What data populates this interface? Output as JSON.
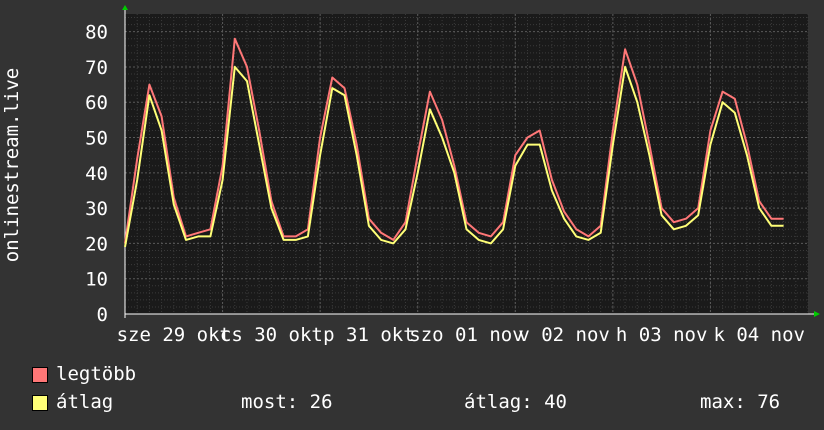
{
  "chart_data": {
    "type": "line",
    "ylabel": "onlinestream.live",
    "ylim": [
      0,
      85
    ],
    "y_ticks": [
      0,
      10,
      20,
      30,
      40,
      50,
      60,
      70,
      80
    ],
    "x_tick_labels": [
      "sze 29 okt",
      "cs 30 okt",
      "p 31 okt",
      "szo 01 nov",
      "v 02 nov",
      "h 03 nov",
      "k 04 nov"
    ],
    "x": [
      "sze 29 okt 00:00",
      "sze 29 okt 03:00",
      "sze 29 okt 06:00",
      "sze 29 okt 09:00",
      "sze 29 okt 12:00",
      "sze 29 okt 15:00",
      "sze 29 okt 18:00",
      "sze 29 okt 21:00",
      "cs 30 okt 00:00",
      "cs 30 okt 03:00",
      "cs 30 okt 06:00",
      "cs 30 okt 09:00",
      "cs 30 okt 12:00",
      "cs 30 okt 15:00",
      "cs 30 okt 18:00",
      "cs 30 okt 21:00",
      "p 31 okt 00:00",
      "p 31 okt 03:00",
      "p 31 okt 06:00",
      "p 31 okt 09:00",
      "p 31 okt 12:00",
      "p 31 okt 15:00",
      "p 31 okt 18:00",
      "p 31 okt 21:00",
      "szo 01 nov 00:00",
      "szo 01 nov 03:00",
      "szo 01 nov 06:00",
      "szo 01 nov 09:00",
      "szo 01 nov 12:00",
      "szo 01 nov 15:00",
      "szo 01 nov 18:00",
      "szo 01 nov 21:00",
      "v 02 nov 00:00",
      "v 02 nov 03:00",
      "v 02 nov 06:00",
      "v 02 nov 09:00",
      "v 02 nov 12:00",
      "v 02 nov 15:00",
      "v 02 nov 18:00",
      "v 02 nov 21:00",
      "h 03 nov 00:00",
      "h 03 nov 03:00",
      "h 03 nov 06:00",
      "h 03 nov 09:00",
      "h 03 nov 12:00",
      "h 03 nov 15:00",
      "h 03 nov 18:00",
      "h 03 nov 21:00",
      "k 04 nov 00:00",
      "k 04 nov 03:00",
      "k 04 nov 06:00",
      "k 04 nov 09:00",
      "k 04 nov 12:00",
      "k 04 nov 15:00",
      "k 04 nov 18:00",
      "k 04 nov 21:00",
      "sze 05 nov 00:00"
    ],
    "series": [
      {
        "name": "legtöbb",
        "color": "#ff7777",
        "values": [
          20,
          44,
          65,
          56,
          33,
          22,
          23,
          24,
          42,
          78,
          70,
          52,
          32,
          22,
          22,
          24,
          50,
          67,
          64,
          48,
          27,
          23,
          21,
          26,
          45,
          63,
          55,
          42,
          26,
          23,
          22,
          26,
          45,
          50,
          52,
          38,
          29,
          24,
          22,
          25,
          52,
          75,
          65,
          48,
          30,
          26,
          27,
          30,
          52,
          63,
          61,
          48,
          32,
          27,
          27
        ]
      },
      {
        "name": "átlag",
        "color": "#ffff77",
        "values": [
          19,
          38,
          62,
          52,
          31,
          21,
          22,
          22,
          38,
          70,
          66,
          48,
          30,
          21,
          21,
          22,
          45,
          64,
          62,
          45,
          25,
          21,
          20,
          24,
          40,
          58,
          50,
          40,
          24,
          21,
          20,
          24,
          42,
          48,
          48,
          35,
          27,
          22,
          21,
          23,
          48,
          70,
          60,
          45,
          28,
          24,
          25,
          28,
          48,
          60,
          57,
          45,
          30,
          25,
          25
        ]
      }
    ],
    "grid": true
  },
  "legend": {
    "max_label": "legtöbb",
    "avg_label": "átlag"
  },
  "stats": {
    "current": "most: 26",
    "average": "átlag: 40",
    "maximum": "max: 76"
  },
  "colors": {
    "background": "#333333",
    "plot_background": "#1a1a1a",
    "grid_minor": "#3a3a3a",
    "grid_major": "#5a5a5a",
    "axis": "#ffffff",
    "axis_arrow": "#00cc00",
    "max_line": "#ff7777",
    "avg_line": "#ffff77"
  }
}
